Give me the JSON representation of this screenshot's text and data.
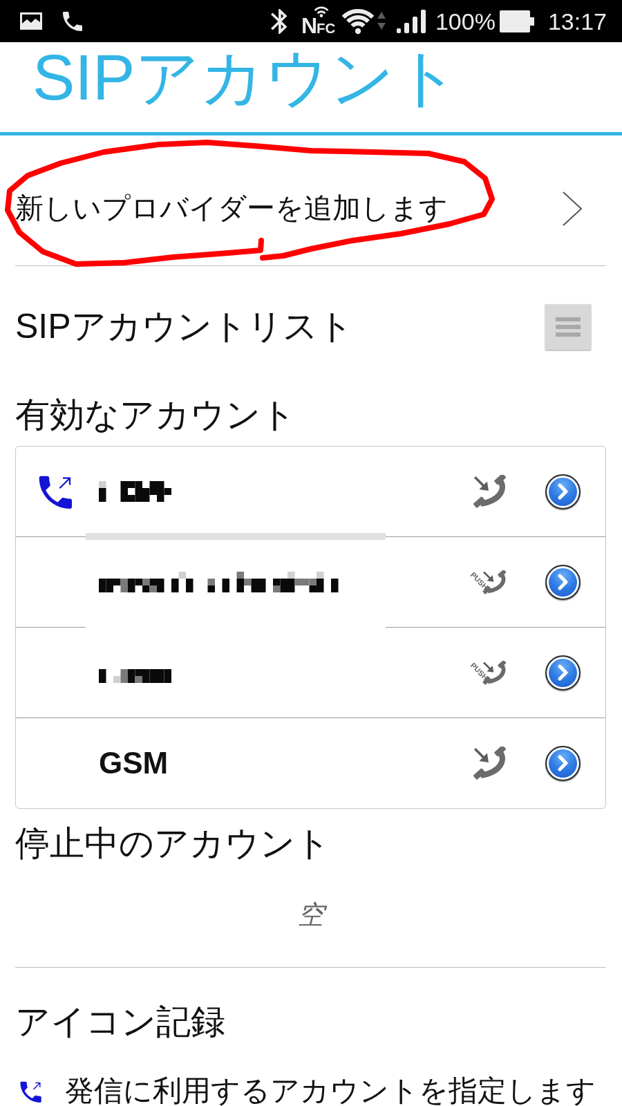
{
  "status_bar": {
    "nfc_label": "N$_{FC}$",
    "battery": "100%",
    "time": "13:17"
  },
  "title": "SIPアカウント",
  "add_provider": {
    "label": "新しいプロバイダーを追加します",
    "circled": true
  },
  "account_list": {
    "title": "SIPアカウントリスト"
  },
  "active_accounts": {
    "title": "有効なアカウント",
    "items": [
      {
        "kind": "redacted",
        "default_outgoing": true,
        "push": false
      },
      {
        "kind": "redacted",
        "default_outgoing": false,
        "push": true,
        "push_label": "PUSH"
      },
      {
        "kind": "redacted",
        "default_outgoing": false,
        "push": true,
        "push_label": "PUSH"
      },
      {
        "kind": "text",
        "name": "GSM",
        "default_outgoing": false,
        "push": false
      }
    ]
  },
  "inactive_accounts": {
    "title": "停止中のアカウント",
    "empty_text": "空"
  },
  "icon_legend": {
    "title": "アイコン記録",
    "items": [
      {
        "kind": "outgoing",
        "text": "発信に利用するアカウントを指定します"
      }
    ]
  }
}
